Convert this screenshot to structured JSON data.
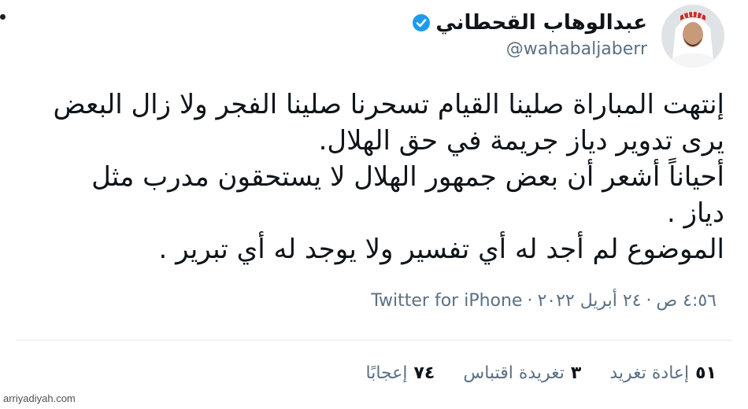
{
  "author": {
    "display_name": "عبدالوهاب القحطاني",
    "handle": "@wahabaljaberr",
    "verified": true
  },
  "tweet": {
    "text": "إنتهت المباراة صلينا القيام تسحرنا صلينا الفجر ولا زال البعض\nيرى تدوير دياز جريمة في حق الهلال.\nأحياناً أشعر أن بعض جمهور الهلال لا يستحقون مدرب مثل\nدياز .\nالموضوع لم أجد له أي تفسير ولا يوجد له أي تبرير .",
    "time": "٤:٥٦ ص",
    "date": "٢٤ أبريل ٢٠٢٢",
    "source": "Twitter for iPhone",
    "separator": "·"
  },
  "stats": [
    {
      "count": "٥١",
      "label": "إعادة تغريد"
    },
    {
      "count": "٣",
      "label": "تغريدة اقتباس"
    },
    {
      "count": "٧٤",
      "label": "إعجابًا"
    }
  ],
  "watermark": "arriyadiyah.com",
  "colors": {
    "text": "#0f1419",
    "secondary": "#5b7083",
    "verified": "#1d9bf0",
    "divider": "#e6ecf0"
  }
}
